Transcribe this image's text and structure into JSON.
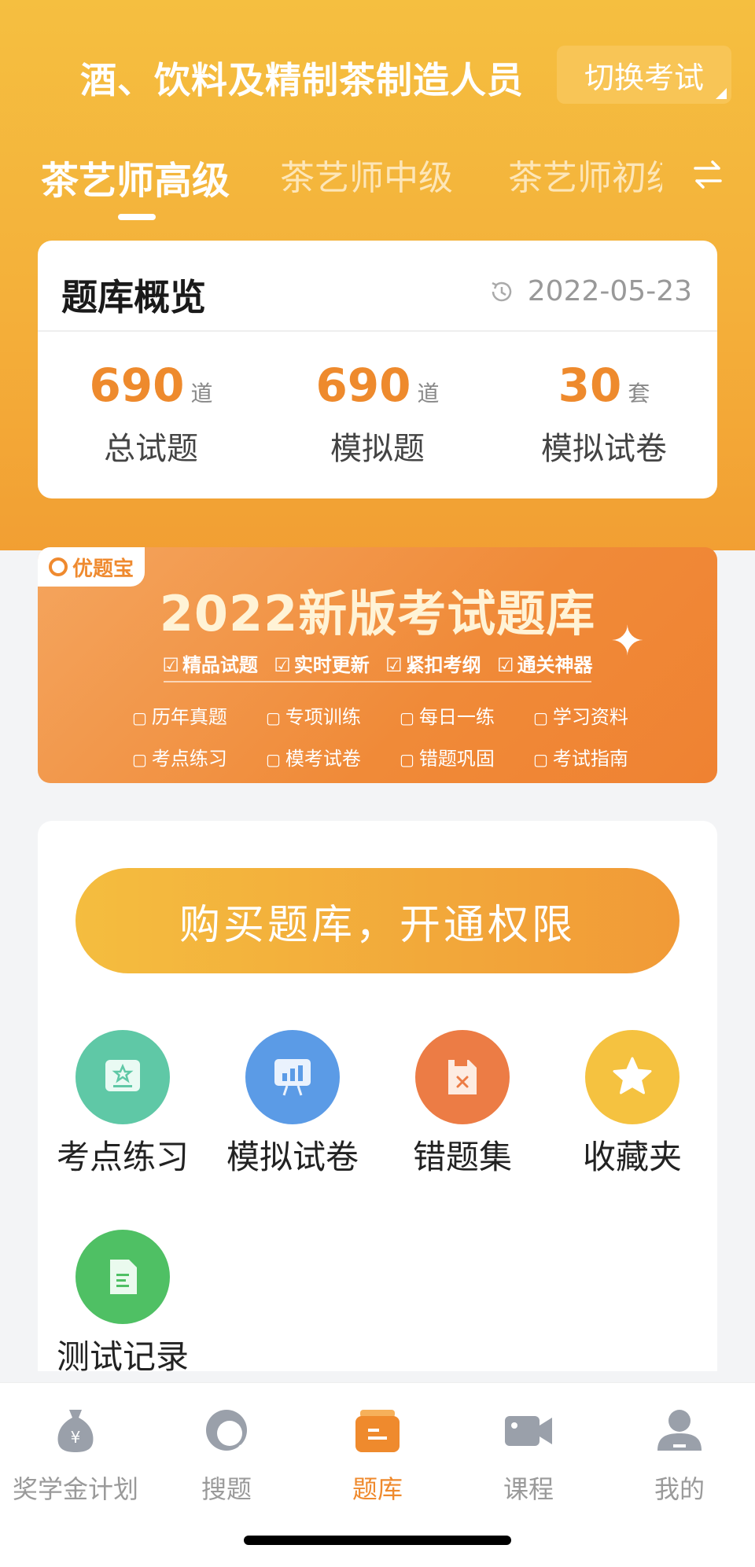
{
  "header": {
    "exam_title": "酒、饮料及精制茶制造人员",
    "switch_label": "切换考试"
  },
  "tabs": [
    {
      "label": "茶艺师高级",
      "active": true
    },
    {
      "label": "茶艺师中级",
      "active": false
    },
    {
      "label": "茶艺师初级",
      "active": false
    }
  ],
  "overview": {
    "title": "题库概览",
    "date": "2022-05-23",
    "stats": [
      {
        "value": "690",
        "unit": "道",
        "label": "总试题"
      },
      {
        "value": "690",
        "unit": "道",
        "label": "模拟题"
      },
      {
        "value": "30",
        "unit": "套",
        "label": "模拟试卷"
      }
    ]
  },
  "banner": {
    "logo": "优题宝",
    "title": "2022新版考试题库",
    "tags": [
      "精品试题",
      "实时更新",
      "紧扣考纲",
      "通关神器"
    ],
    "features": [
      "历年真题",
      "专项训练",
      "每日一练",
      "学习资料",
      "考点练习",
      "模考试卷",
      "错题巩固",
      "考试指南"
    ]
  },
  "buy_button": "购买题库，开通权限",
  "tools": [
    {
      "label": "考点练习",
      "icon": "certificate-icon",
      "color": "#5fc8a6"
    },
    {
      "label": "模拟试卷",
      "icon": "presentation-chart-icon",
      "color": "#5b9be6"
    },
    {
      "label": "错题集",
      "icon": "wrong-doc-icon",
      "color": "#ec7c45"
    },
    {
      "label": "收藏夹",
      "icon": "star-icon",
      "color": "#f5c240"
    },
    {
      "label": "测试记录",
      "icon": "document-icon",
      "color": "#4fc064"
    }
  ],
  "nav": [
    {
      "label": "奖学金计划",
      "icon": "money-bag-icon",
      "active": false
    },
    {
      "label": "搜题",
      "icon": "search-q-icon",
      "active": false
    },
    {
      "label": "题库",
      "icon": "question-bank-icon",
      "active": true
    },
    {
      "label": "课程",
      "icon": "video-camera-icon",
      "active": false
    },
    {
      "label": "我的",
      "icon": "person-icon",
      "active": false
    }
  ],
  "colors": {
    "accent": "#ef8a2d",
    "hero": "#f5bf40"
  }
}
